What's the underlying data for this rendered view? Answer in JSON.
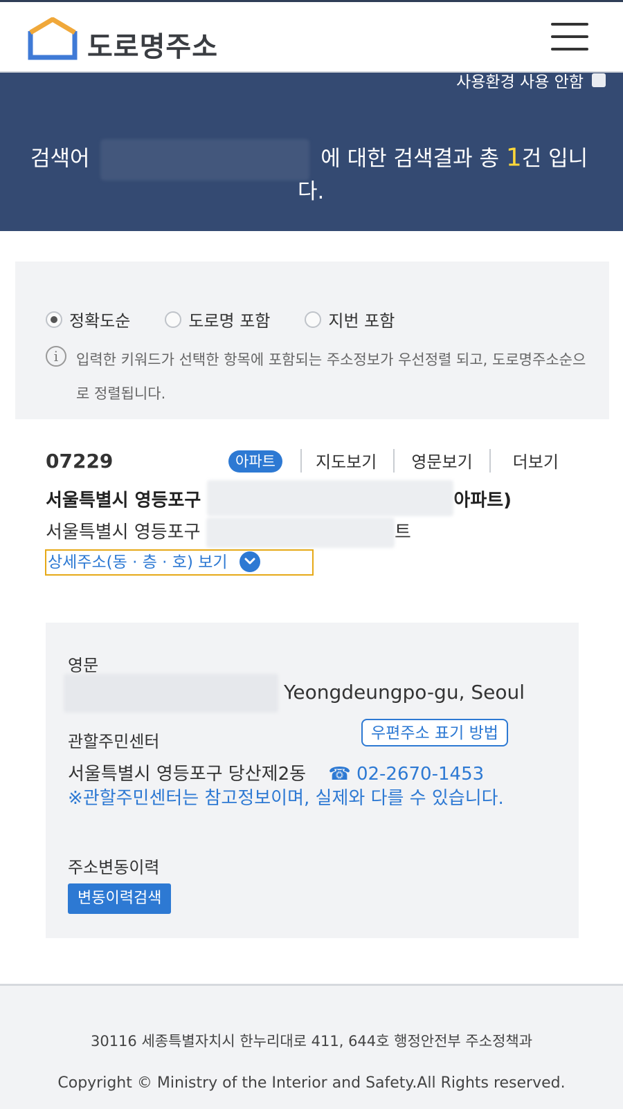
{
  "header": {
    "logo_text": "도로명주소",
    "colors": {
      "logo_blue": "#3f7ad6",
      "logo_orange": "#f0a83a"
    }
  },
  "banner": {
    "env_toggle_label": "사용환경 사용 안함",
    "result_prefix": "검색어",
    "result_mid": "에 대한 검색결과 총",
    "result_count": "1",
    "result_suffix": "건 입니",
    "result_suffix2": "다.",
    "colors": {
      "background": "#344a72",
      "count": "#ffd83a"
    }
  },
  "filter": {
    "options": [
      {
        "label": "정확도순",
        "selected": true
      },
      {
        "label": "도로명 포함",
        "selected": false
      },
      {
        "label": "지번 포함",
        "selected": false
      }
    ],
    "info_text": "입력한 키워드가 선택한 항목에 포함되는 주소정보가 우선정렬 되고, 도로명주소순으로 정렬됩니다."
  },
  "result": {
    "zipcode": "07229",
    "badge": "아파트",
    "tabs": [
      "지도보기",
      "영문보기",
      "더보기"
    ],
    "road_address_prefix": "서울특별시 영등포구",
    "road_address_suffix": "아파트)",
    "jibun_address_prefix": "서울특별시 영등포구",
    "jibun_address_suffix": "트",
    "detail_toggle_label": "상세주소(동 · 층 · 호) 보기"
  },
  "detail": {
    "english_label": "영문",
    "english_address_suffix": "Yeongdeungpo-gu, Seoul",
    "center_label": "관할주민센터",
    "postal_button": "우편주소 표기 방법",
    "center_name": "서울특별시 영등포구 당산제2동",
    "phone_icon": "☎",
    "phone": "02-2670-1453",
    "notice": "※관할주민센터는 참고정보이며, 실제와 다를 수 있습니다.",
    "history_label": "주소변동이력",
    "history_button": "변동이력검색",
    "colors": {
      "accent": "#2d79d3"
    }
  },
  "footer": {
    "address": "30116 세종특별자치시 한누리대로 411, 644호 행정안전부 주소정책과",
    "copyright": "Copyright © Ministry of the Interior and Safety.All Rights reserved."
  }
}
